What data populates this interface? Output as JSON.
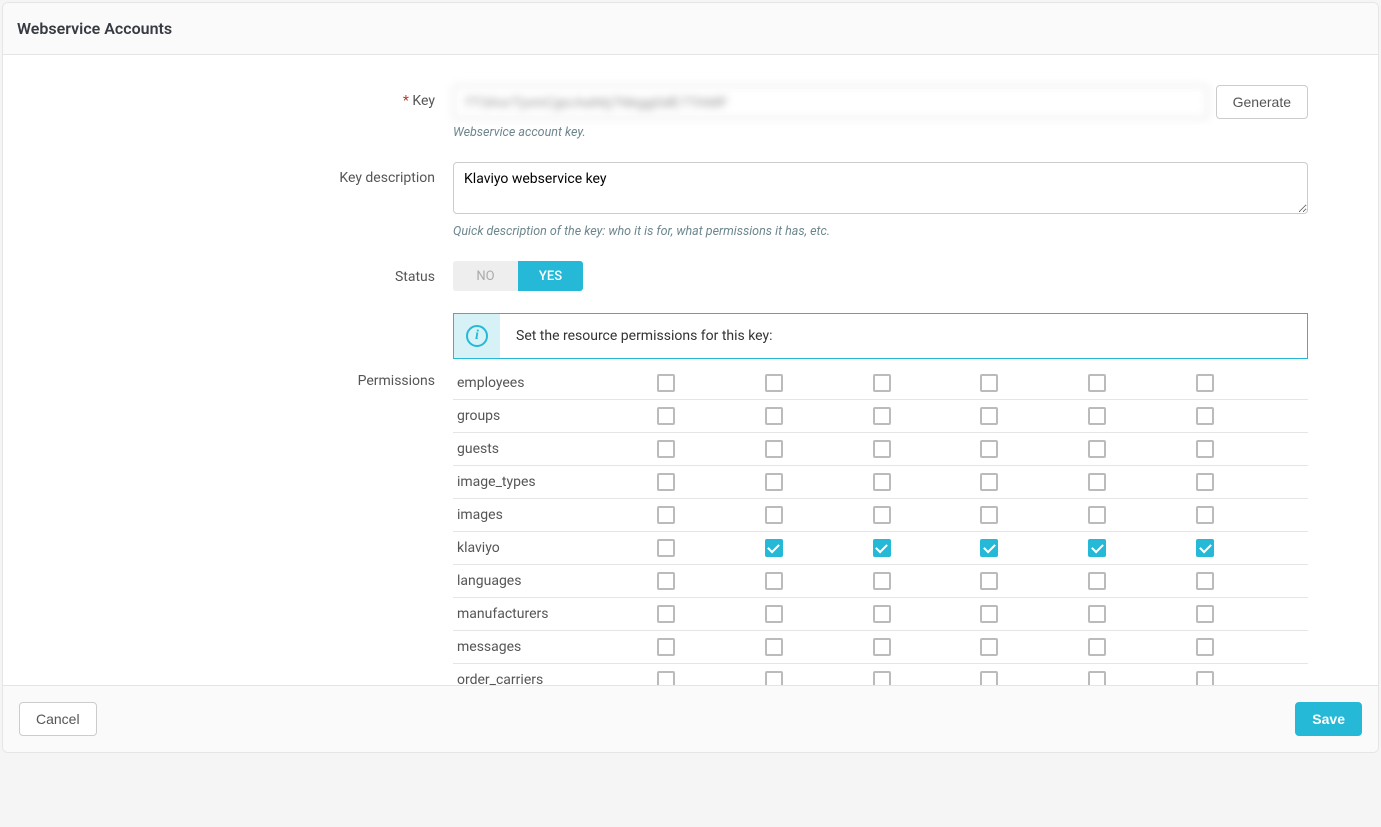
{
  "header": {
    "title": "Webservice Accounts"
  },
  "form": {
    "key": {
      "label": "Key",
      "required": true,
      "value": "7T3AxrTjxmCjpcAaNtj7Nkgg0dE7TAMF",
      "help": "Webservice account key.",
      "generate_label": "Generate"
    },
    "description": {
      "label": "Key description",
      "value": "Klaviyo webservice key",
      "help": "Quick description of the key: who it is for, what permissions it has, etc."
    },
    "status": {
      "label": "Status",
      "no_label": "NO",
      "yes_label": "YES",
      "value": true
    },
    "permissions": {
      "label": "Permissions",
      "info_text": "Set the resource permissions for this key:",
      "rows": [
        {
          "name": "employees",
          "checks": [
            false,
            false,
            false,
            false,
            false,
            false
          ]
        },
        {
          "name": "groups",
          "checks": [
            false,
            false,
            false,
            false,
            false,
            false
          ]
        },
        {
          "name": "guests",
          "checks": [
            false,
            false,
            false,
            false,
            false,
            false
          ]
        },
        {
          "name": "image_types",
          "checks": [
            false,
            false,
            false,
            false,
            false,
            false
          ]
        },
        {
          "name": "images",
          "checks": [
            false,
            false,
            false,
            false,
            false,
            false
          ]
        },
        {
          "name": "klaviyo",
          "checks": [
            false,
            true,
            true,
            true,
            true,
            true
          ]
        },
        {
          "name": "languages",
          "checks": [
            false,
            false,
            false,
            false,
            false,
            false
          ]
        },
        {
          "name": "manufacturers",
          "checks": [
            false,
            false,
            false,
            false,
            false,
            false
          ]
        },
        {
          "name": "messages",
          "checks": [
            false,
            false,
            false,
            false,
            false,
            false
          ]
        },
        {
          "name": "order_carriers",
          "checks": [
            false,
            false,
            false,
            false,
            false,
            false
          ]
        }
      ]
    }
  },
  "footer": {
    "cancel_label": "Cancel",
    "save_label": "Save"
  }
}
